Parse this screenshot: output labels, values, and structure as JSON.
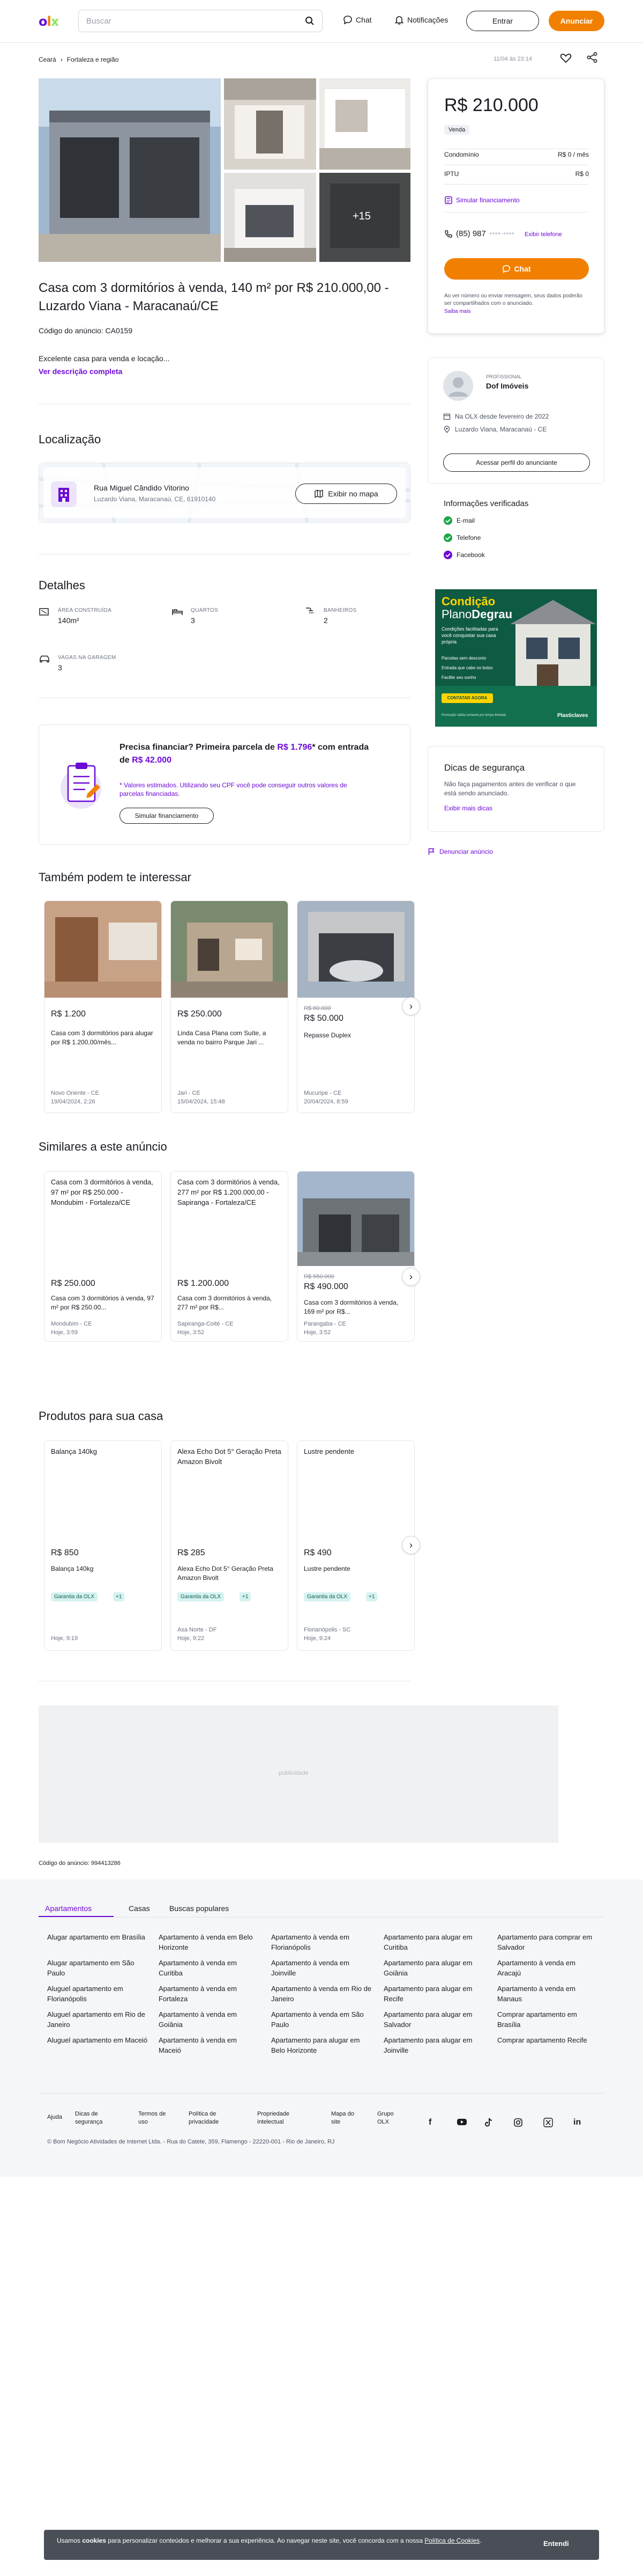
{
  "header": {
    "logo": {
      "o": "o",
      "l": "l",
      "x": "x"
    },
    "search_placeholder": "Buscar",
    "chat": "Chat",
    "notifications": "Notificações",
    "login": "Entrar",
    "announce": "Anunciar"
  },
  "breadcrumb": {
    "item1": "Ceará",
    "sep": "›",
    "item2": "Fortaleza e região"
  },
  "published": "11/04 às 23:14",
  "gallery": {
    "more": "+15"
  },
  "listing": {
    "title": "Casa com 3 dormitórios à venda, 140 m² por R$ 210.000,00 - Luzardo Viana - Maracanaú/CE",
    "code": "Código do anúncio: CA0159",
    "excerpt": "Excelente casa para venda e locação...",
    "see_more": "Ver descrição completa"
  },
  "location": {
    "heading": "Localização",
    "street": "Rua Miguel Cândido Vitorino",
    "area": "Luzardo Viana, Maracanaú, CE, 61910140",
    "map_button": "Exibir no mapa"
  },
  "details": {
    "heading": "Detalhes",
    "items": [
      {
        "label": "ÁREA CONSTRUÍDA",
        "value": "140m²"
      },
      {
        "label": "QUARTOS",
        "value": "3"
      },
      {
        "label": "BANHEIROS",
        "value": "2"
      },
      {
        "label": "VAGAS NA GARAGEM",
        "value": "3"
      }
    ]
  },
  "financing": {
    "title_1": "Precisa financiar? Primeira parcela de ",
    "title_price": "R$ 1.796",
    "title_2": "* com entrada de ",
    "title_down": "R$ 42.000",
    "note": "* Valores estimados. Utilizando seu CPF você pode conseguir outros valores de parcelas financiadas.",
    "button": "Simular financiamento"
  },
  "sidebar": {
    "price": "R$ 210.000",
    "badge": "Venda",
    "condominio_label": "Condomínio",
    "condominio_value": "R$ 0 / mês",
    "iptu_label": "IPTU",
    "iptu_value": "R$ 0",
    "simulate": "Simular financiamento",
    "phone": "(85) 987",
    "phone_hidden": "••••-••••",
    "show_phone": "Exibir telefone",
    "chat": "Chat",
    "safety_note": "Ao ver número ou enviar mensagem, seus dados poderão ser compartilhados com o anunciado.",
    "know_more": "Saiba mais",
    "seller_type": "PROFISSIONAL",
    "seller_name": "Dof Imóveis",
    "since": "Na OLX desde fevereiro de 2022",
    "seller_location": "Luzardo Viana, Maracanaú - CE",
    "profile_button": "Acessar perfil do anunciante",
    "verified_heading": "Informações verificadas",
    "verified": [
      "E-mail",
      "Telefone",
      "Facebook"
    ],
    "ad_brand_1": "Condição",
    "ad_brand_2": "Plano",
    "ad_brand_3": "Degrau",
    "ad_headline": "Condições facilitadas para você conquistar sua casa própria",
    "ad_points": [
      "Parcelas sem desconto",
      "Entrada que cabe no bolso",
      "Facilite seu sonho"
    ],
    "ad_button": "CONTATAR AGORA",
    "ad_footer": "Promoção válida somente por tempo limitado",
    "ad_logo": "Plasticlaves",
    "tips_heading": "Dicas de segurança",
    "tips_text": "Não faça pagamentos antes de verificar o que está sendo anunciado.",
    "tips_link": "Exibir mais dicas",
    "report": "Denunciar anúncio"
  },
  "also_interest": {
    "heading": "Também podem te interessar",
    "cards": [
      {
        "price": "R$ 1.200",
        "old_price": "",
        "desc": "Casa com 3 dormitórios para alugar por R$ 1.200,00/mês...",
        "loc": "Novo Oriente - CE",
        "date": "19/04/2024, 2:26"
      },
      {
        "price": "R$ 250.000",
        "old_price": "",
        "desc": "Linda Casa Plana com Suíte, a venda no bairro Parque Jari ...",
        "loc": "Jari - CE",
        "date": "15/04/2024, 15:48"
      },
      {
        "price": "R$ 50.000",
        "old_price": "R$ 60.000",
        "desc": "Repasse Duplex",
        "loc": "Mucuripe - CE",
        "date": "20/04/2024, 8:59"
      }
    ]
  },
  "similar": {
    "heading": "Similares a este anúncio",
    "cards": [
      {
        "title": "Casa com 3 dormitórios à venda, 97 m² por R$ 250.000 - Mondubim - Fortaleza/CE",
        "price": "R$ 250.000",
        "old_price": "",
        "desc": "Casa com 3 dormitórios à venda, 97 m² por R$ 250.00...",
        "loc": "Mondubim - CE",
        "date": "Hoje, 3:59"
      },
      {
        "title": "Casa com 3 dormitórios à venda, 277 m² por R$ 1.200.000,00 - Sapiranga - Fortaleza/CE",
        "price": "R$ 1.200.000",
        "old_price": "",
        "desc": "Casa com 3 dormitórios à venda, 277 m² por R$...",
        "loc": "Sapiranga-Coité - CE",
        "date": "Hoje, 3:52"
      },
      {
        "title": "",
        "price": "R$ 490.000",
        "old_price": "R$ 550.000",
        "desc": "Casa com 3 dormitórios à venda, 169 m² por R$...",
        "loc": "Parangaba - CE",
        "date": "Hoje, 3:52"
      }
    ]
  },
  "products": {
    "heading": "Produtos para sua casa",
    "cards": [
      {
        "title": "Balança 140kg",
        "price": "R$ 850",
        "desc": "Balança 140kg",
        "tag": "Garantia da OLX",
        "tag_n": "+1",
        "loc": "",
        "date": "Hoje, 9:19"
      },
      {
        "title": "Alexa Echo Dot 5° Geração Preta Amazon Bivolt",
        "price": "R$ 285",
        "desc": "Alexa Echo Dot 5° Geração Preta Amazon Bivolt",
        "tag": "Garantia da OLX",
        "tag_n": "+1",
        "loc": "Asa Norte - DF",
        "date": "Hoje, 9:22"
      },
      {
        "title": "Lustre pendente",
        "price": "R$ 490",
        "desc": "Lustre pendente",
        "tag": "Garantia da OLX",
        "tag_n": "+1",
        "loc": "Florianópolis - SC",
        "date": "Hoje, 9:24"
      }
    ]
  },
  "ad_slot": "publicidade",
  "footer_code": "Código do anúncio: 994413286",
  "footer": {
    "tabs": [
      "Apartamentos",
      "Casas",
      "Buscas populares"
    ],
    "columns": [
      [
        "Alugar apartamento em Brasília",
        "Alugar apartamento em São Paulo",
        "Aluguel apartamento em Florianópolis",
        "Aluguel apartamento em Rio de Janeiro",
        "Aluguel apartamento em Maceió"
      ],
      [
        "Apartamento à venda em Belo Horizonte",
        "Apartamento à venda em Curitiba",
        "Apartamento à venda em Fortaleza",
        "Apartamento à venda em Goiânia",
        "Apartamento à venda em Maceió"
      ],
      [
        "Apartamento à venda em Florianópolis",
        "Apartamento à venda em Joinville",
        "Apartamento à venda em Rio de Janeiro",
        "Apartamento à venda em São Paulo",
        "Apartamento para alugar em Belo Horizonte"
      ],
      [
        "Apartamento para alugar em Curitiba",
        "Apartamento para alugar em Goiânia",
        "Apartamento para alugar em Recife",
        "Apartamento para alugar em Salvador",
        "Apartamento para alugar em Joinville"
      ],
      [
        "Apartamento para comprar em Salvador",
        "Apartamento à venda em Aracajú",
        "Apartamento à venda em Manaus",
        "Comprar apartamento em Brasília",
        "Comprar apartamento Recife"
      ]
    ],
    "bottom_links": [
      "Ajuda",
      "Dicas de segurança",
      "Termos de uso",
      "Política de privacidade",
      "Propriedade intelectual",
      "Mapa do site",
      "Grupo OLX"
    ],
    "copyright": "© Bom Negócio Atividades de Internet Ltda. - Rua do Catete, 359, Flamengo - 22220-001 - Rio de Janeiro, RJ"
  },
  "cookie": {
    "text_1": "Usamos ",
    "text_bold": "cookies",
    "text_2": " para personalizar conteúdos e melhorar a sua experiência. Ao navegar neste site, você concorda com a nossa ",
    "link": "Política de Cookies",
    "text_3": ".",
    "button": "Entendi"
  },
  "colors": {
    "purple": "#6d0ad6",
    "orange": "#f28000",
    "green": "#8ce563"
  }
}
